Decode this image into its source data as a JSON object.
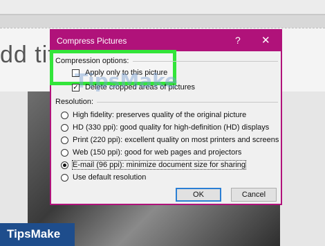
{
  "background": {
    "slide_title": "dd tit"
  },
  "dialog": {
    "title": "Compress Pictures",
    "help_symbol": "?",
    "close_symbol": "✕",
    "compression_options_label": "Compression options:",
    "apply_only_label": "Apply only to this picture",
    "apply_only_checked": false,
    "delete_cropped_label": "Delete cropped areas of pictures",
    "delete_cropped_checked": true,
    "resolution_label": "Resolution:",
    "resolution_options": [
      {
        "label": "High fidelity: preserves quality of the original picture",
        "selected": false
      },
      {
        "label": "HD (330 ppi): good quality for high-definition (HD) displays",
        "selected": false
      },
      {
        "label": "Print (220 ppi): excellent quality on most printers and screens",
        "selected": false
      },
      {
        "label": "Web (150 ppi): good for web pages and projectors",
        "selected": false
      },
      {
        "label": "E-mail (96 ppi): minimize document size for sharing",
        "selected": true
      },
      {
        "label": "Use default resolution",
        "selected": false
      }
    ],
    "ok_label": "OK",
    "cancel_label": "Cancel",
    "accent_color": "#b0127a",
    "highlight_color": "#33e53a"
  },
  "watermark": "TipsMake",
  "brand": "TipsMake"
}
